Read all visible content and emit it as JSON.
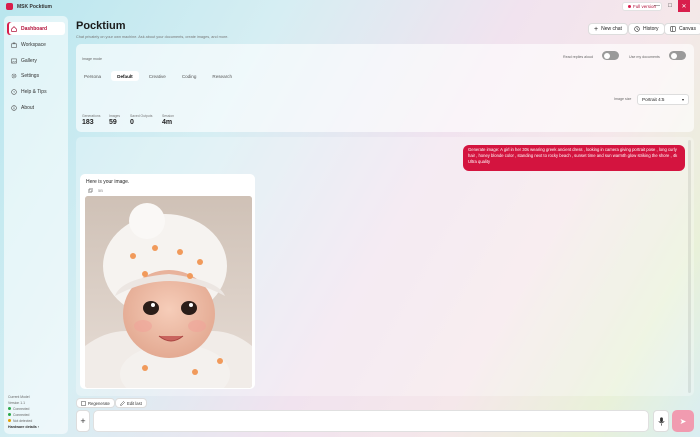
{
  "window": {
    "title": "MSK Pocktium",
    "full_version": "Full version",
    "minimize": "—",
    "maximize": "☐",
    "close": "✕"
  },
  "sidebar": {
    "items": [
      {
        "label": "Dashboard",
        "icon": "home-icon"
      },
      {
        "label": "Workspace",
        "icon": "briefcase-icon"
      },
      {
        "label": "Gallery",
        "icon": "image-icon"
      },
      {
        "label": "Settings",
        "icon": "gear-icon"
      },
      {
        "label": "Help & Tips",
        "icon": "help-icon"
      },
      {
        "label": "About",
        "icon": "info-icon"
      }
    ],
    "footer": {
      "model_label": "Current Model",
      "version": "Version 1.1",
      "status_1": "Connected",
      "status_2": "Connected",
      "status_3": "Not detected",
      "hardware_link": "Hardware details ›"
    }
  },
  "header": {
    "title": "Pocktium",
    "subtitle": "Chat privately on your own machine. Ask about your documents, create images, and more.",
    "buttons": {
      "new_chat": "New chat",
      "history": "History",
      "canvas": "Canvas"
    }
  },
  "settings": {
    "image_mode_label": "Image mode",
    "read_replies_label": "Read replies aloud",
    "use_docs_label": "Use my documents",
    "tabs": [
      "Persona",
      "Default",
      "Creative",
      "Coding",
      "Research"
    ],
    "active_tab": "Default",
    "image_size_label": "Image size",
    "image_size_value": "Portrait 4:5",
    "stats": [
      {
        "label": "Generations",
        "value": "183"
      },
      {
        "label": "Images",
        "value": "59"
      },
      {
        "label": "Saved Outputs",
        "value": "0"
      },
      {
        "label": "Session",
        "value": "4m"
      }
    ]
  },
  "chat": {
    "user_message": "Generate image: A girl in her 30s wearing greek ancient dress , looking in camera giving portrait pose , long curly hair , honey blonde color , standing next to rocky beach , sunset time and sun warmth glow striking the shore , 4k Ultra quality",
    "ai_message": "Here is your image.",
    "ai_meta_icon": "copy-icon",
    "ai_meta_text": "5B"
  },
  "bottom": {
    "regenerate": "Regenerate",
    "edit_last": "Edit last",
    "plus": "+",
    "prompt_placeholder": "",
    "send": "➤"
  },
  "colors": {
    "accent": "#d81e4c",
    "user_bubble": "#d4143f",
    "send_disabled": "#f19bb0"
  }
}
